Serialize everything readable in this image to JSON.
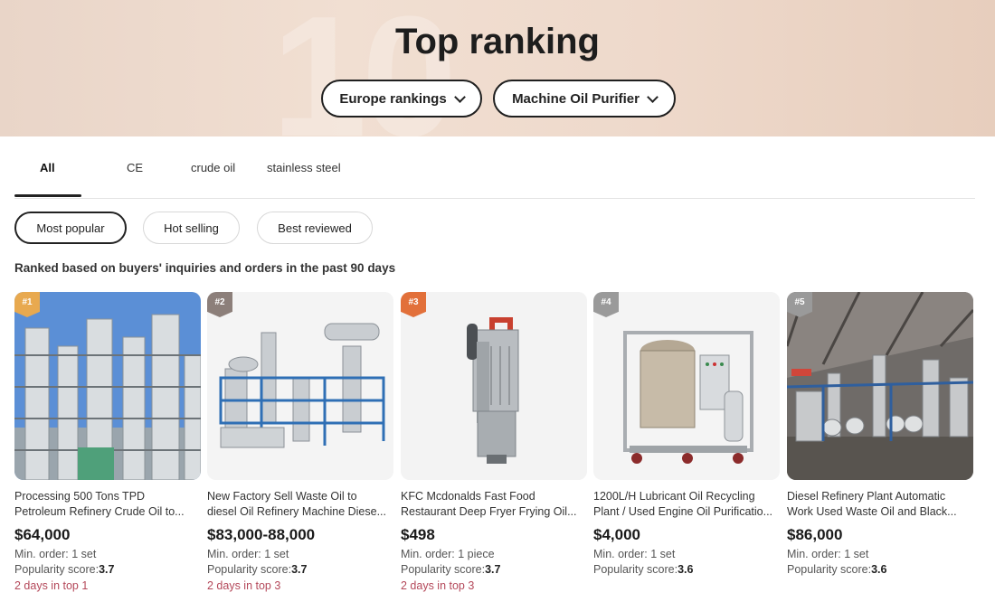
{
  "header": {
    "title": "Top ranking",
    "region_select": "Europe rankings",
    "category_select": "Machine Oil Purifier"
  },
  "tabs": [
    {
      "label": "All",
      "active": true
    },
    {
      "label": "CE",
      "active": false
    },
    {
      "label": "crude oil",
      "active": false
    },
    {
      "label": "stainless steel",
      "active": false
    }
  ],
  "sort_chips": [
    {
      "label": "Most popular",
      "active": true
    },
    {
      "label": "Hot selling",
      "active": false
    },
    {
      "label": "Best reviewed",
      "active": false
    }
  ],
  "ranked_note": "Ranked based on buyers' inquiries and orders in the past 90 days",
  "products": [
    {
      "rank": "#1",
      "badge_color": "#e8a94f",
      "title": "Processing 500 Tons TPD Petroleum Refinery Crude Oil to...",
      "price": "$64,000",
      "min_order": "Min. order: 1 set",
      "popularity_label": "Popularity score:",
      "popularity_value": "3.7",
      "days_in_top": "2 days in top 1",
      "image_icon": "refinery-tower-icon"
    },
    {
      "rank": "#2",
      "badge_color": "#8c7f7a",
      "title": "New Factory Sell Waste Oil to diesel Oil Refinery Machine Diese...",
      "price": "$83,000-88,000",
      "min_order": "Min. order: 1 set",
      "popularity_label": "Popularity score:",
      "popularity_value": "3.7",
      "days_in_top": "2 days in top 3",
      "image_icon": "refinery-plant-icon"
    },
    {
      "rank": "#3",
      "badge_color": "#e2703a",
      "title": "KFC Mcdonalds Fast Food Restaurant Deep Fryer Frying Oil...",
      "price": "$498",
      "min_order": "Min. order: 1 piece",
      "popularity_label": "Popularity score:",
      "popularity_value": "3.7",
      "days_in_top": "2 days in top 3",
      "image_icon": "oil-filter-icon"
    },
    {
      "rank": "#4",
      "badge_color": "#9a9a9a",
      "title": "1200L/H Lubricant Oil Recycling Plant / Used Engine Oil Purificatio...",
      "price": "$4,000",
      "min_order": "Min. order: 1 set",
      "popularity_label": "Popularity score:",
      "popularity_value": "3.6",
      "days_in_top": "",
      "image_icon": "oil-purifier-cart-icon"
    },
    {
      "rank": "#5",
      "badge_color": "#9a9a9a",
      "title": "Diesel Refinery Plant Automatic Work Used Waste Oil and Black...",
      "price": "$86,000",
      "min_order": "Min. order: 1 set",
      "popularity_label": "Popularity score:",
      "popularity_value": "3.6",
      "days_in_top": "",
      "image_icon": "factory-hall-icon"
    }
  ]
}
